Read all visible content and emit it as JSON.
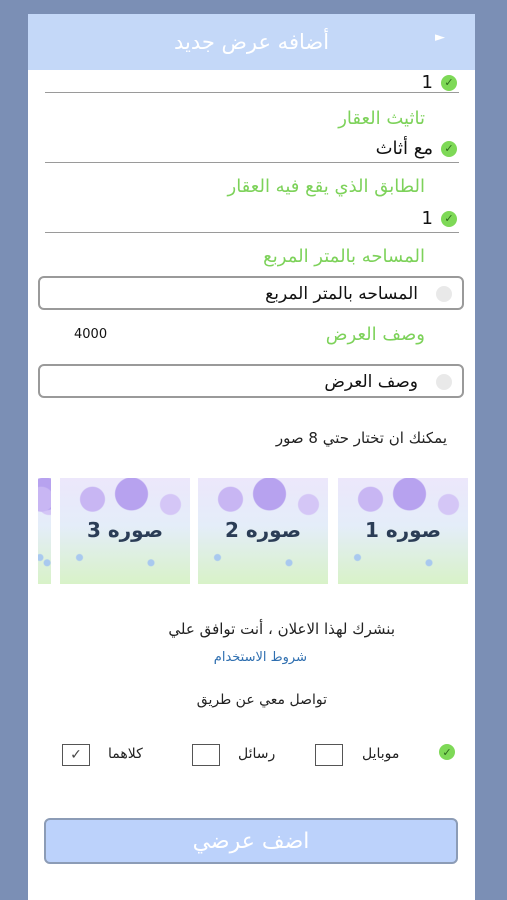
{
  "header": {
    "title": "أضافه عرض جديد",
    "back_icon": "play-arrow-icon"
  },
  "fields": {
    "prev_value": "1",
    "furnishing_label": "تاثيث العقار",
    "furnishing_value": "مع أثاث",
    "floor_label": "الطابق الذي يقع فيه العقار",
    "floor_value": "1",
    "area_label": "المساحه بالمتر المربع",
    "area_placeholder": "المساحه بالمتر المربع",
    "desc_counter": "4000",
    "desc_label": "وصف العرض",
    "desc_placeholder": "وصف العرض"
  },
  "photos": {
    "hint": "يمكنك ان تختار حتي 8 صور",
    "items": [
      "صوره 1",
      "صوره 2",
      "صوره 3"
    ]
  },
  "terms": {
    "text": "بنشرك لهذا الاعلان ، أنت توافق علي",
    "link": "شروط الاستخدام"
  },
  "contact": {
    "title": "تواصل معي عن طريق",
    "options": [
      {
        "label": "موبايل",
        "checked": false
      },
      {
        "label": "رسائل",
        "checked": false
      },
      {
        "label": "كلاهما",
        "checked": true
      }
    ]
  },
  "submit_label": "اضف عرضي",
  "colors": {
    "accent_green": "#7ed957",
    "header_bg": "#c4d8f8",
    "page_bg": "#7b8fb5",
    "link": "#2f6fb0"
  }
}
